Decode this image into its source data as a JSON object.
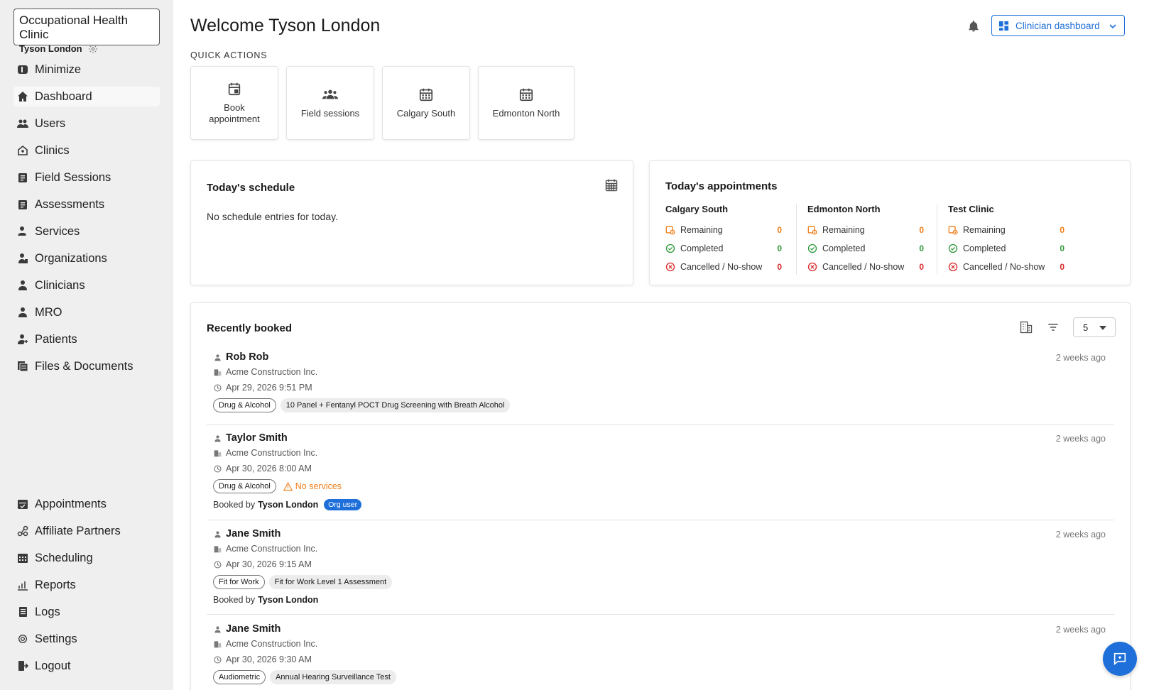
{
  "sidebar": {
    "clinic_name": "Occupational Health Clinic",
    "user_name": "Tyson London",
    "top_items": [
      {
        "label": "Minimize",
        "icon": "minimize-icon"
      },
      {
        "label": "Dashboard",
        "icon": "home-icon",
        "active": true
      },
      {
        "label": "Users",
        "icon": "users-icon"
      },
      {
        "label": "Clinics",
        "icon": "clinic-icon"
      },
      {
        "label": "Field Sessions",
        "icon": "clipboard-icon"
      },
      {
        "label": "Assessments",
        "icon": "clipboard-icon"
      },
      {
        "label": "Services",
        "icon": "services-icon"
      },
      {
        "label": "Organizations",
        "icon": "organization-icon"
      },
      {
        "label": "Clinicians",
        "icon": "clinician-icon"
      },
      {
        "label": "MRO",
        "icon": "mro-icon"
      },
      {
        "label": "Patients",
        "icon": "patients-icon"
      },
      {
        "label": "Files & Documents",
        "icon": "files-icon"
      }
    ],
    "bottom_items": [
      {
        "label": "Appointments",
        "icon": "appointments-icon"
      },
      {
        "label": "Affiliate Partners",
        "icon": "partners-icon"
      },
      {
        "label": "Scheduling",
        "icon": "scheduling-icon"
      },
      {
        "label": "Reports",
        "icon": "reports-icon"
      },
      {
        "label": "Logs",
        "icon": "logs-icon"
      },
      {
        "label": "Settings",
        "icon": "gear-icon"
      },
      {
        "label": "Logout",
        "icon": "logout-icon"
      }
    ]
  },
  "header": {
    "welcome": "Welcome Tyson London",
    "dashboard_select": "Clinician dashboard"
  },
  "quick_actions": {
    "label": "QUICK ACTIONS",
    "items": [
      {
        "label": "Book appointment",
        "icon": "calendar-add-icon"
      },
      {
        "label": "Field sessions",
        "icon": "group-icon"
      },
      {
        "label": "Calgary South",
        "icon": "calendar-icon"
      },
      {
        "label": "Edmonton North",
        "icon": "calendar-icon"
      }
    ]
  },
  "schedule": {
    "title": "Today's schedule",
    "empty_text": "No schedule entries for today."
  },
  "appointments": {
    "title": "Today's appointments",
    "clinics": [
      {
        "name": "Calgary South",
        "remaining_label": "Remaining",
        "remaining": "0",
        "completed_label": "Completed",
        "completed": "0",
        "cancelled_label": "Cancelled / No-show",
        "cancelled": "0"
      },
      {
        "name": "Edmonton North",
        "remaining_label": "Remaining",
        "remaining": "0",
        "completed_label": "Completed",
        "completed": "0",
        "cancelled_label": "Cancelled / No-show",
        "cancelled": "0"
      },
      {
        "name": "Test Clinic",
        "remaining_label": "Remaining",
        "remaining": "0",
        "completed_label": "Completed",
        "completed": "0",
        "cancelled_label": "Cancelled / No-show",
        "cancelled": "0"
      }
    ]
  },
  "recent": {
    "title": "Recently booked",
    "page_size": "5",
    "bookings": [
      {
        "name": "Rob Rob",
        "org": "Acme Construction Inc.",
        "datetime": "Apr 29, 2026 9:51 PM",
        "ago": "2 weeks ago",
        "category": "Drug & Alcohol",
        "service": "10 Panel + Fentanyl POCT Drug Screening with Breath Alcohol"
      },
      {
        "name": "Taylor Smith",
        "org": "Acme Construction Inc.",
        "datetime": "Apr 30, 2026 8:00 AM",
        "ago": "2 weeks ago",
        "category": "Drug & Alcohol",
        "warning": "No services",
        "booked_by_label": "Booked by",
        "booked_by": "Tyson London",
        "badge": "Org user"
      },
      {
        "name": "Jane Smith",
        "org": "Acme Construction Inc.",
        "datetime": "Apr 30, 2026 9:15 AM",
        "ago": "2 weeks ago",
        "category": "Fit for Work",
        "service": "Fit for Work Level 1 Assessment",
        "booked_by_label": "Booked by",
        "booked_by": "Tyson London"
      },
      {
        "name": "Jane Smith",
        "org": "Acme Construction Inc.",
        "datetime": "Apr 30, 2026 9:30 AM",
        "ago": "2 weeks ago",
        "category": "Audiometric",
        "service": "Annual Hearing Surveillance Test"
      }
    ]
  },
  "colors": {
    "accent": "#1e6fd9",
    "remaining": "#f07f1a",
    "completed": "#2e9a3a",
    "cancelled": "#d92b2b"
  }
}
